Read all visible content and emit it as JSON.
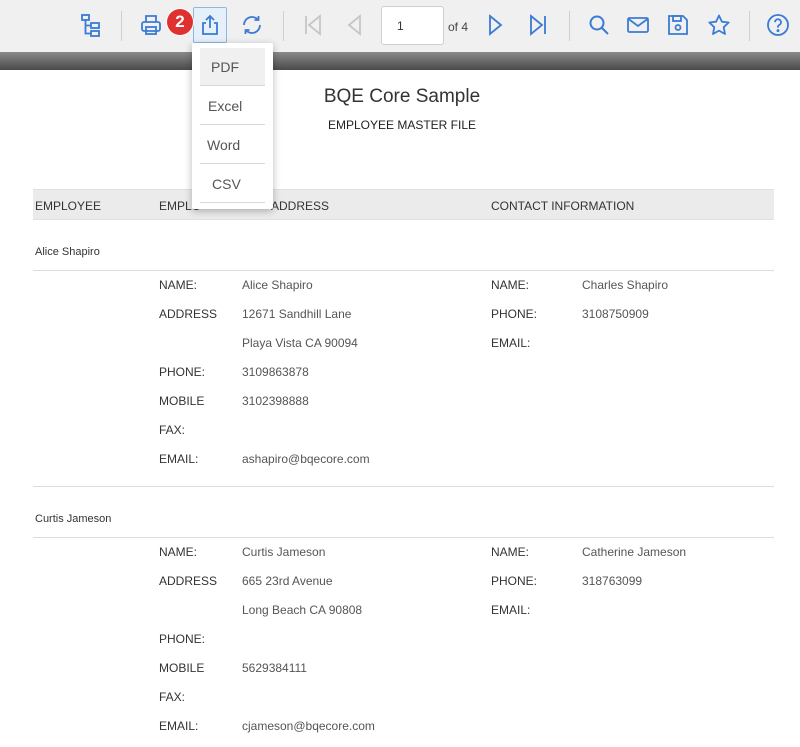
{
  "toolbar": {
    "buttons": [
      {
        "name": "document-map-icon"
      },
      {
        "name": "print-icon"
      },
      {
        "name": "export-icon"
      },
      {
        "name": "refresh-icon"
      },
      {
        "name": "first-page-icon"
      },
      {
        "name": "previous-page-icon"
      },
      {
        "name": "next-page-icon"
      },
      {
        "name": "last-page-icon"
      },
      {
        "name": "search-icon"
      },
      {
        "name": "email-icon"
      },
      {
        "name": "save-icon"
      },
      {
        "name": "favorite-star-icon"
      },
      {
        "name": "help-icon"
      }
    ],
    "page_value": "1",
    "page_of": "of 4",
    "badge": "2",
    "accent": "#3a7bd5",
    "disabled": "#c6c6c6",
    "badge_color": "#e03131"
  },
  "export_menu": {
    "items": [
      "PDF",
      "Excel",
      "Word",
      "CSV"
    ],
    "highlighted": "PDF"
  },
  "report": {
    "title": "BQE Core Sample",
    "subtitle": "EMPLOYEE MASTER FILE",
    "columns": [
      "EMPLOYEE",
      "EMPLO",
      "ADDRESS",
      "CONTACT INFORMATION"
    ],
    "employees": [
      {
        "name": "Alice Shapiro",
        "name_label": "NAME:",
        "name_value": "Alice Shapiro",
        "address_label": "ADDRESS",
        "address_line1": "12671 Sandhill Lane",
        "address_line2": "Playa Vista CA 90094",
        "phone_label": "PHONE:",
        "phone_value": "3109863878",
        "mobile_label": "MOBILE",
        "mobile_value": "3102398888",
        "fax_label": "FAX:",
        "fax_value": "",
        "email_label": "EMAIL:",
        "email_value": "ashapiro@bqecore.com",
        "contact_name_label": "NAME:",
        "contact_name": "Charles Shapiro",
        "contact_phone_label": "PHONE:",
        "contact_phone": "3108750909",
        "contact_email_label": "EMAIL:",
        "contact_email": ""
      },
      {
        "name": "Curtis Jameson",
        "name_label": "NAME:",
        "name_value": "Curtis Jameson",
        "address_label": "ADDRESS",
        "address_line1": "665 23rd Avenue",
        "address_line2": "Long Beach CA 90808",
        "phone_label": "PHONE:",
        "phone_value": "",
        "mobile_label": "MOBILE",
        "mobile_value": "5629384111",
        "fax_label": "FAX:",
        "fax_value": "",
        "email_label": "EMAIL:",
        "email_value": "cjameson@bqecore.com",
        "contact_name_label": "NAME:",
        "contact_name": "Catherine Jameson",
        "contact_phone_label": "PHONE:",
        "contact_phone": "318763099",
        "contact_email_label": "EMAIL:",
        "contact_email": ""
      }
    ]
  }
}
